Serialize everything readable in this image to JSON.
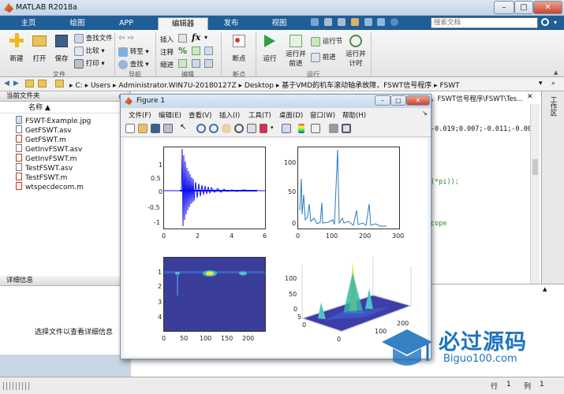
{
  "window": {
    "title": "MATLAB R2018a",
    "buttons": [
      "–",
      "□",
      "✕"
    ]
  },
  "tabs": [
    {
      "label": "主页"
    },
    {
      "label": "绘图"
    },
    {
      "label": "APP"
    },
    {
      "label": "编辑器"
    },
    {
      "label": "发布"
    },
    {
      "label": "视图"
    }
  ],
  "search": {
    "placeholder": "搜索文档"
  },
  "ribbon": {
    "file": {
      "new": "新建",
      "open": "打开",
      "save": "保存",
      "find_files": "查找文件",
      "compare": "比较",
      "print": "打印",
      "section": "文件"
    },
    "navigate": {
      "goto": "转至",
      "find": "查找",
      "section": "导航"
    },
    "edit": {
      "insert": "插入",
      "comment": "注释",
      "indent": "缩进",
      "section": "编辑"
    },
    "breakpoints": {
      "label": "断点",
      "section": "断点"
    },
    "run": {
      "run": "运行",
      "run_advance_1": "运行并",
      "run_advance_2": "前进",
      "run_section": "运行节",
      "advance": "前进",
      "run_time_1": "运行并",
      "run_time_2": "计时",
      "section": "运行"
    }
  },
  "address": {
    "path": [
      "C:",
      "Users",
      "Administrator.WIN7U-20180127Z",
      "Desktop",
      "基于VMD的机车滚动轴承故障，FSWT信号程序",
      "FSWT"
    ]
  },
  "left_panel": {
    "header": "当前文件夹",
    "column": "名称",
    "files": [
      "FSWT-Example.jpg",
      "GetFSWT.asv",
      "GetFSWT.m",
      "GetInvFSWT.asv",
      "GetInvFSWT.m",
      "TestFSWT.asv",
      "TestFSWT.m",
      "wtspecdecom.m"
    ],
    "details_header": "详细信息",
    "details_hint": "选择文件以查看详细信息"
  },
  "editor": {
    "path_fragment": "，FSWT信号程序\\FSWT\\Tes...",
    "lines": [
      "-0.019;0.007;-0.011;-0.00",
      "(*pi));",
      "cope"
    ]
  },
  "right_dock": {
    "label": "工作区"
  },
  "statusbar": {
    "row_label": "行",
    "row": "1",
    "col_label": "列",
    "col": "1"
  },
  "figure": {
    "title": "Figure 1",
    "menu": [
      "文件(F)",
      "编辑(E)",
      "查看(V)",
      "插入(I)",
      "工具(T)",
      "桌面(D)",
      "窗口(W)",
      "帮助(H)"
    ],
    "plots": [
      {
        "xticks": [
          "0",
          "2",
          "4",
          "6"
        ],
        "yticks": [
          "1",
          "0.5",
          "0",
          "-0.5",
          "-1"
        ]
      },
      {
        "xticks": [
          "0",
          "100",
          "200",
          "300"
        ],
        "yticks": [
          "100",
          "50",
          "0"
        ]
      },
      {
        "xticks": [
          "0",
          "50",
          "100",
          "150",
          "200"
        ],
        "yticks": [
          "1",
          "2",
          "3",
          "4"
        ]
      },
      {
        "xticks": [
          "0",
          "100",
          "200"
        ],
        "yticks": [
          "100",
          "50",
          "0"
        ],
        "zticks": [
          "0",
          "5"
        ]
      }
    ]
  },
  "watermark": {
    "brand": "必过源码",
    "url": "Biguo100.com"
  },
  "colors": {
    "tab_bar": "#1f5e97",
    "signal": "#1010ee",
    "spectrum": "#2b7bbf",
    "heatmap_bg": "#3a3d99"
  }
}
